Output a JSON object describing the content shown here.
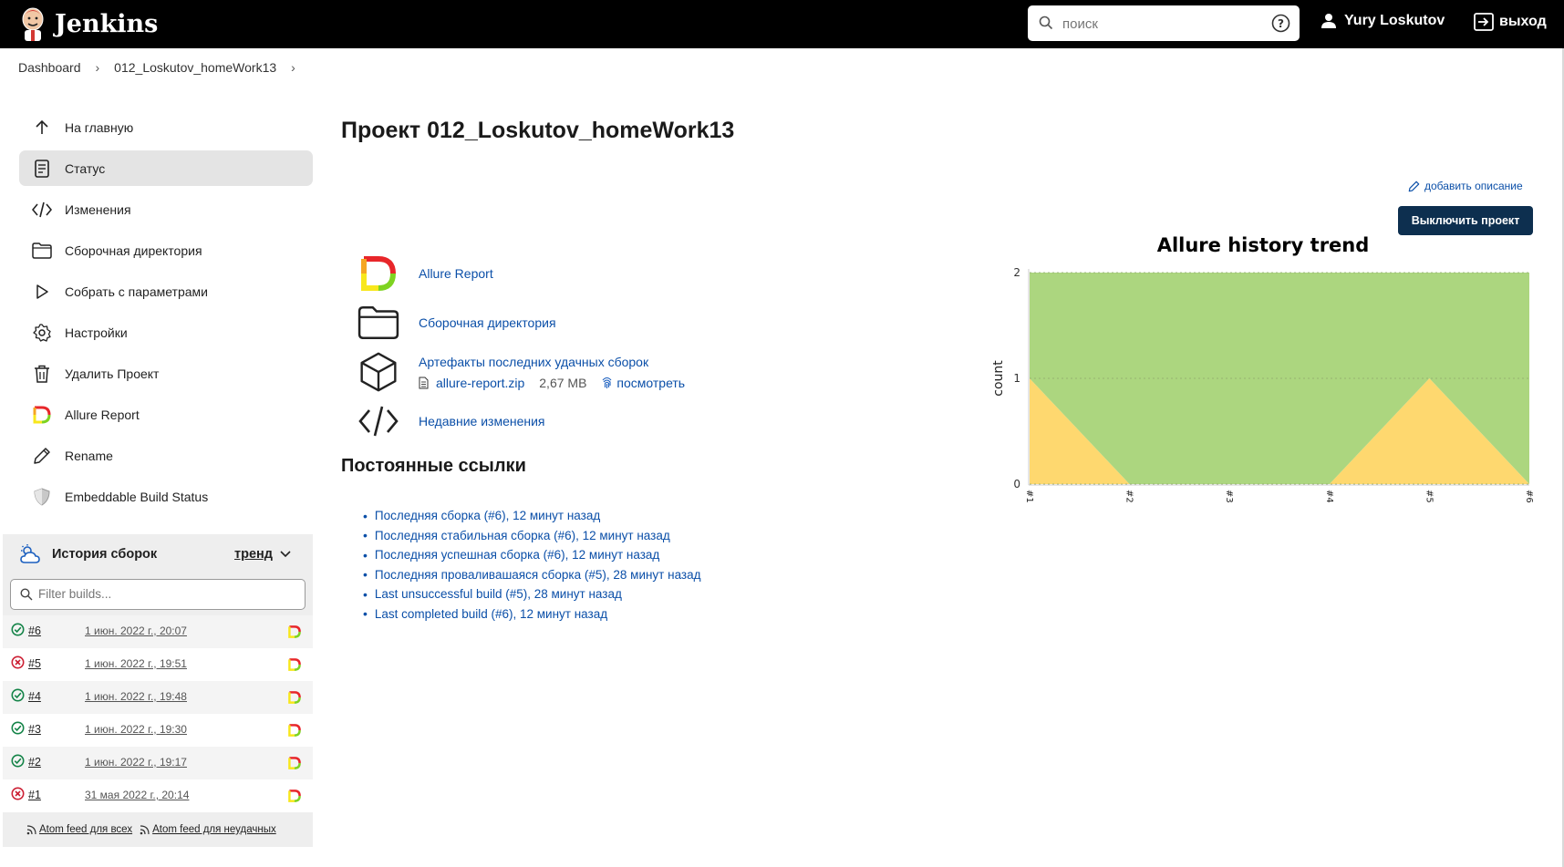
{
  "header": {
    "logo_text": "Jenkins",
    "search_placeholder": "поиск",
    "user_name": "Yury Loskutov",
    "logout_label": "выход"
  },
  "breadcrumb": {
    "items": [
      "Dashboard",
      "012_Loskutov_homeWork13"
    ]
  },
  "sidebar": {
    "items": [
      {
        "label": "На главную",
        "icon": "arrow-up-icon"
      },
      {
        "label": "Статус",
        "icon": "document-icon",
        "active": true
      },
      {
        "label": "Изменения",
        "icon": "code-icon"
      },
      {
        "label": "Сборочная директория",
        "icon": "folder-icon"
      },
      {
        "label": "Собрать с параметрами",
        "icon": "play-icon"
      },
      {
        "label": "Настройки",
        "icon": "gear-icon"
      },
      {
        "label": "Удалить Проект",
        "icon": "trash-icon"
      },
      {
        "label": "Allure Report",
        "icon": "allure-icon"
      },
      {
        "label": "Rename",
        "icon": "pencil-icon"
      },
      {
        "label": "Embeddable Build Status",
        "icon": "shield-icon"
      }
    ]
  },
  "history": {
    "title": "История сборок",
    "trend_label": "тренд",
    "filter_placeholder": "Filter builds...",
    "builds": [
      {
        "number": "#6",
        "date": "1 июн. 2022 г., 20:07",
        "status": "success"
      },
      {
        "number": "#5",
        "date": "1 июн. 2022 г., 19:51",
        "status": "failed"
      },
      {
        "number": "#4",
        "date": "1 июн. 2022 г., 19:48",
        "status": "success"
      },
      {
        "number": "#3",
        "date": "1 июн. 2022 г., 19:30",
        "status": "success"
      },
      {
        "number": "#2",
        "date": "1 июн. 2022 г., 19:17",
        "status": "success"
      },
      {
        "number": "#1",
        "date": "31 мая 2022 г., 20:14",
        "status": "failed"
      }
    ],
    "feed_all": "Atom feed для всех",
    "feed_failed": "Atom feed для неудачных"
  },
  "main": {
    "title": "Проект 012_Loskutov_homeWork13",
    "add_description": "добавить описание",
    "disable_button": "Выключить проект",
    "links": {
      "allure": "Allure Report",
      "workspace": "Сборочная директория",
      "artifacts": "Артефакты последних удачных сборок",
      "artifact_file": "allure-report.zip",
      "artifact_size": "2,67 MB",
      "artifact_view": "посмотреть",
      "changes": "Недавние изменения"
    },
    "permalinks_title": "Постоянные ссылки",
    "permalinks": [
      "Последняя сборка (#6), 12 минут назад",
      "Последняя стабильная сборка (#6), 12 минут назад",
      "Последняя успешная сборка (#6), 12 минут назад",
      "Последняя проваливашаяся сборка (#5), 28 минут назад",
      "Last unsuccessful build (#5), 28 минут назад",
      "Last completed build (#6), 12 минут назад"
    ]
  },
  "colors": {
    "passed": "#acd67f",
    "broken": "#fed86f",
    "header_bg": "#000000",
    "link": "#0b4fa8",
    "button_bg": "#0d2f4f"
  },
  "chart_data": {
    "type": "area",
    "title": "Allure history trend",
    "ylabel": "count",
    "xlabel": "",
    "categories": [
      "#1",
      "#2",
      "#3",
      "#4",
      "#5",
      "#6"
    ],
    "ylim": [
      0,
      2
    ],
    "yticks": [
      "0",
      "1",
      "2"
    ],
    "stacked": true,
    "series": [
      {
        "values": [
          1,
          0,
          0,
          0,
          1,
          0
        ],
        "color": "#fed86f"
      },
      {
        "values": [
          1,
          2,
          2,
          2,
          1,
          2
        ],
        "color": "#acd67f"
      }
    ]
  }
}
